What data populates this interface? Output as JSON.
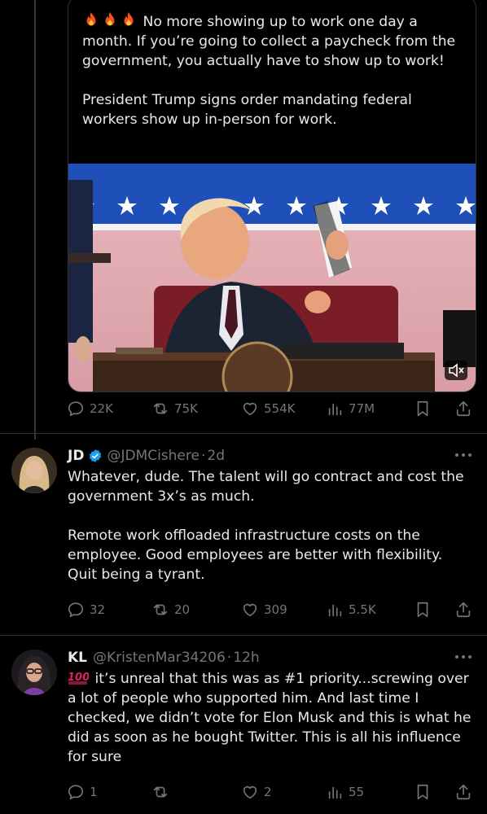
{
  "quoted_post": {
    "text_line1": " No more showing up to work one day a month. If you’re going to collect a paycheck from the government, you actually have to show up to work!",
    "text_line2": "President Trump signs order mandating federal workers show up in-person for work.",
    "emoji": [
      "fire-icon",
      "fire-icon",
      "fire-icon"
    ],
    "stats": {
      "replies": "22K",
      "reposts": "75K",
      "likes": "554K",
      "views": "77M"
    }
  },
  "replies": [
    {
      "name": "JD",
      "verified": true,
      "handle": "@JDMCishere",
      "time": "2d",
      "text": "Whatever, dude. The talent will go contract and cost the government 3x’s as much.\n\nRemote work offloaded infrastructure costs on the employee. Good employees are better with flexibility. Quit being a tyrant.",
      "stats": {
        "replies": "32",
        "reposts": "20",
        "likes": "309",
        "views": "5.5K"
      }
    },
    {
      "name": "KL",
      "verified": false,
      "handle": "@KristenMar34206",
      "time": "12h",
      "emoji": "hundred-points-icon",
      "text": " it’s unreal that this was as #1 priority...screwing over a lot of people who supported him. And last time I checked, we didn’t vote for Elon Musk and this is what he did as soon as he bought Twitter. This is all his influence for sure",
      "stats": {
        "replies": "1",
        "reposts": "",
        "likes": "2",
        "views": "55"
      }
    }
  ],
  "separator": "·",
  "colors": {
    "background": "#000000",
    "text": "#e7e9ea",
    "muted": "#71767b",
    "verified": "#1d9bf0",
    "border": "#2f3336"
  }
}
